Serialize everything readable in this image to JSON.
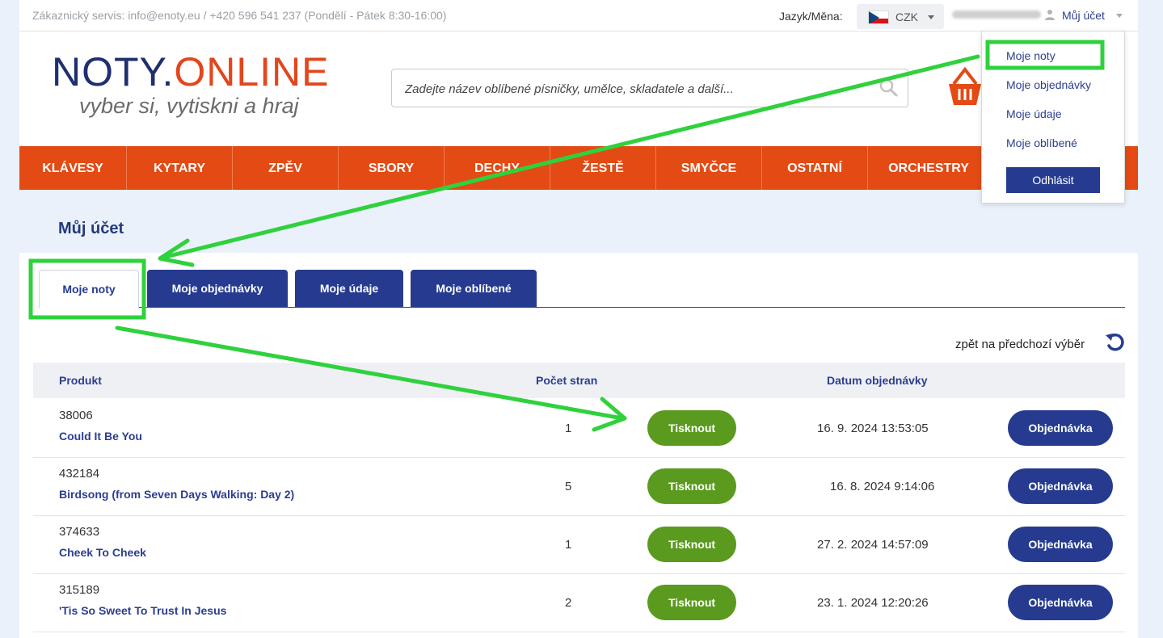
{
  "topbar": {
    "contact": "Zákaznický servis: info@enoty.eu / +420 596 541 237 (Pondělí - Pátek 8:30-16:00)",
    "lang_label": "Jazyk/Měna:",
    "currency": "CZK",
    "account_label": "Můj účet"
  },
  "header": {
    "logo_main": "NOTY.",
    "logo_accent": "ONLINE",
    "logo_sub": "vyber si, vytiskni a hraj",
    "search_placeholder": "Zadejte název oblíbené písničky, umělce, skladatele a další..."
  },
  "nav": {
    "items": [
      "KLÁVESY",
      "KYTARY",
      "ZPĚV",
      "SBORY",
      "DECHY",
      "ŽESTĚ",
      "SMYČCE",
      "OSTATNÍ",
      "ORCHESTRY"
    ]
  },
  "dropdown": {
    "items": [
      "Moje noty",
      "Moje objednávky",
      "Moje údaje",
      "Moje oblíbené"
    ],
    "logout": "Odhlásit"
  },
  "account": {
    "title": "Můj účet",
    "tabs": [
      "Moje noty",
      "Moje objednávky",
      "Moje údaje",
      "Moje oblíbené"
    ],
    "back_link": "zpět na předchozí výběr"
  },
  "table": {
    "headers": {
      "product": "Produkt",
      "pages": "Počet stran",
      "date": "Datum objednávky"
    },
    "print_label": "Tisknout",
    "order_label": "Objednávka",
    "rows": [
      {
        "id": "38006",
        "name": "Could It Be You",
        "pages": "1",
        "date": "16. 9. 2024 13:53:05"
      },
      {
        "id": "432184",
        "name": "Birdsong (from Seven Days Walking: Day 2)",
        "pages": "5",
        "date": "16. 8. 2024 9:14:06"
      },
      {
        "id": "374633",
        "name": "Cheek To Cheek",
        "pages": "1",
        "date": "27. 2. 2024 14:57:09"
      },
      {
        "id": "315189",
        "name": "'Tis So Sweet To Trust In Jesus",
        "pages": "2",
        "date": "23. 1. 2024 12:20:26"
      }
    ]
  }
}
